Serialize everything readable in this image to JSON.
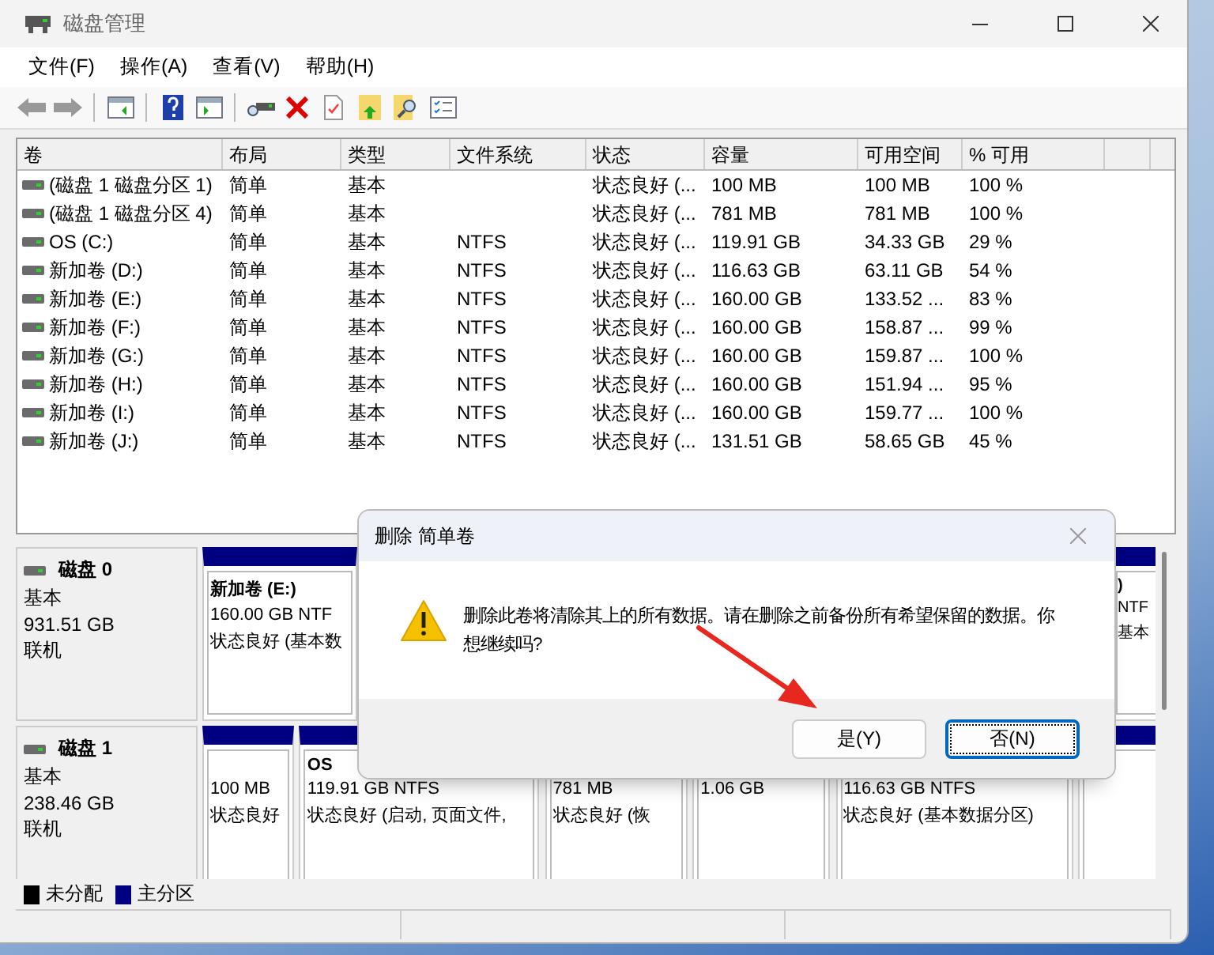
{
  "window": {
    "title": "磁盘管理"
  },
  "menu": [
    "文件(F)",
    "操作(A)",
    "查看(V)",
    "帮助(H)"
  ],
  "table": {
    "columns": [
      "卷",
      "布局",
      "类型",
      "文件系统",
      "状态",
      "容量",
      "可用空间",
      "% 可用"
    ],
    "rows": [
      {
        "volume": "(磁盘 1 磁盘分区 1)",
        "layout": "简单",
        "type": "基本",
        "status": "状态良好 (...",
        "capacity": "100 MB",
        "free": "100 MB",
        "percent": "100 %"
      },
      {
        "volume": "(磁盘 1 磁盘分区 4)",
        "layout": "简单",
        "type": "基本",
        "status": "状态良好 (...",
        "capacity": "781 MB",
        "free": "781 MB",
        "percent": "100 %"
      },
      {
        "volume": "OS (C:)",
        "layout": "简单",
        "type": "基本",
        "fs": "NTFS",
        "status": "状态良好 (...",
        "capacity": "119.91 GB",
        "free": "34.33 GB",
        "percent": "29 %"
      },
      {
        "volume": "新加卷 (D:)",
        "layout": "简单",
        "type": "基本",
        "fs": "NTFS",
        "status": "状态良好 (...",
        "capacity": "116.63 GB",
        "free": "63.11 GB",
        "percent": "54 %"
      },
      {
        "volume": "新加卷 (E:)",
        "layout": "简单",
        "type": "基本",
        "fs": "NTFS",
        "status": "状态良好 (...",
        "capacity": "160.00 GB",
        "free": "133.52 ...",
        "percent": "83 %"
      },
      {
        "volume": "新加卷 (F:)",
        "layout": "简单",
        "type": "基本",
        "fs": "NTFS",
        "status": "状态良好 (...",
        "capacity": "160.00 GB",
        "free": "158.87 ...",
        "percent": "99 %"
      },
      {
        "volume": "新加卷 (G:)",
        "layout": "简单",
        "type": "基本",
        "fs": "NTFS",
        "status": "状态良好 (...",
        "capacity": "160.00 GB",
        "free": "159.87 ...",
        "percent": "100 %"
      },
      {
        "volume": "新加卷 (H:)",
        "layout": "简单",
        "type": "基本",
        "fs": "NTFS",
        "status": "状态良好 (...",
        "capacity": "160.00 GB",
        "free": "151.94 ...",
        "percent": "95 %"
      },
      {
        "volume": "新加卷 (I:)",
        "layout": "简单",
        "type": "基本",
        "fs": "NTFS",
        "status": "状态良好 (...",
        "capacity": "160.00 GB",
        "free": "159.77 ...",
        "percent": "100 %"
      },
      {
        "volume": "新加卷 (J:)",
        "layout": "简单",
        "type": "基本",
        "fs": "NTFS",
        "status": "状态良好 (...",
        "capacity": "131.51 GB",
        "free": "58.65 GB",
        "percent": "45 %"
      }
    ]
  },
  "disks": [
    {
      "name": "磁盘 0",
      "type": "基本",
      "size": "931.51 GB",
      "status": "联机",
      "partitions": [
        {
          "kind": "primary",
          "name": "新加卷  (E:)",
          "size": "160.00 GB NTF",
          "status": "状态良好 (基本数"
        },
        {
          "kind": "primary",
          "name": ")",
          "size": "NTF",
          "status": "基本"
        }
      ]
    },
    {
      "name": "磁盘 1",
      "type": "基本",
      "size": "238.46 GB",
      "status": "联机",
      "partitions": [
        {
          "kind": "primary",
          "size": "100 MB",
          "status": "状态良好"
        },
        {
          "kind": "primary",
          "name": "OS",
          "size": "119.91 GB NTFS",
          "status": "状态良好 (启动, 页面文件,"
        },
        {
          "kind": "primary",
          "size": "781 MB",
          "status": "状态良好 (恢"
        },
        {
          "kind": "primary",
          "size": "1.06 GB"
        },
        {
          "kind": "primary",
          "size": "116.63 GB NTFS",
          "status": "状态良好 (基本数据分区)"
        },
        {
          "kind": "primary"
        }
      ]
    }
  ],
  "legend": [
    {
      "label": "未分配",
      "color": "#000000"
    },
    {
      "label": "主分区",
      "color": "#000080"
    }
  ],
  "dialog": {
    "title": "删除 简单卷",
    "message": "删除此卷将清除其上的所有数据。请在删除之前备份所有希望保留的数据。你想继续吗?",
    "buttons": [
      {
        "label": "是(Y)",
        "focused": false
      },
      {
        "label": "否(N)",
        "focused": true
      }
    ]
  }
}
